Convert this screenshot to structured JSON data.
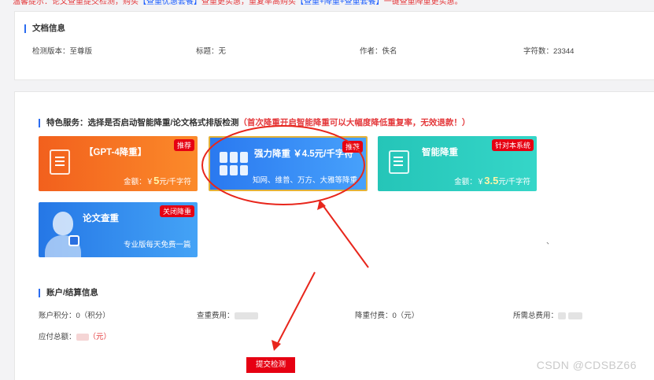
{
  "notice": {
    "prefix": "温馨提示：论文查重提交检测，购买",
    "link1": "【查重优惠套餐】",
    "mid": "查重更实惠，重复率高购买",
    "link2": "【查重+降重+查重套餐】",
    "suffix": "一键查重降重更实惠。"
  },
  "doc_info": {
    "title": "文档信息",
    "version_label": "检测版本：至尊版",
    "title_label": "标题：无",
    "author_label": "作者：佚名",
    "wordcount_label": "字符数：23344"
  },
  "special": {
    "title": "特色服务：选择是否启动智能降重/论文格式排版检测",
    "hint": "（首次降重开启智能降重可以大幅度降低重复率，无效退款！）",
    "cards": [
      {
        "title": "【GPT-4降重】",
        "tag": "推荐",
        "foot_prefix": "金额：￥",
        "price": "5",
        "foot_suffix": "元/千字符"
      },
      {
        "title": "强力降重 ￥4.5元/千字符",
        "tag": "推荐",
        "subtitle": "知网、维普、万方、大雅等降重"
      },
      {
        "title": "智能降重",
        "tag": "针对本系统",
        "foot_prefix": "金额：￥",
        "price": "3.5",
        "foot_suffix": "元/千字符"
      },
      {
        "title": "论文查重",
        "tag": "关闭降重",
        "subtitle": "专业版每天免费一篇"
      }
    ],
    "stray_mark": "、"
  },
  "account": {
    "title": "账户/结算信息",
    "points_label": "账户积分：0（积分）",
    "check_fee_label": "查重费用：",
    "reduce_fee_label": "降重付费：0（元）",
    "total_fee_label": "所需总费用：",
    "payable_label": "应付总额：",
    "payable_unit": "（元）"
  },
  "submit_label": "提交检测",
  "watermark": "CSDN @CDSBZ66",
  "colors": {
    "accent_red": "#e60012",
    "accent_blue": "#2b6cf0",
    "annotation_red": "#e8261c"
  }
}
